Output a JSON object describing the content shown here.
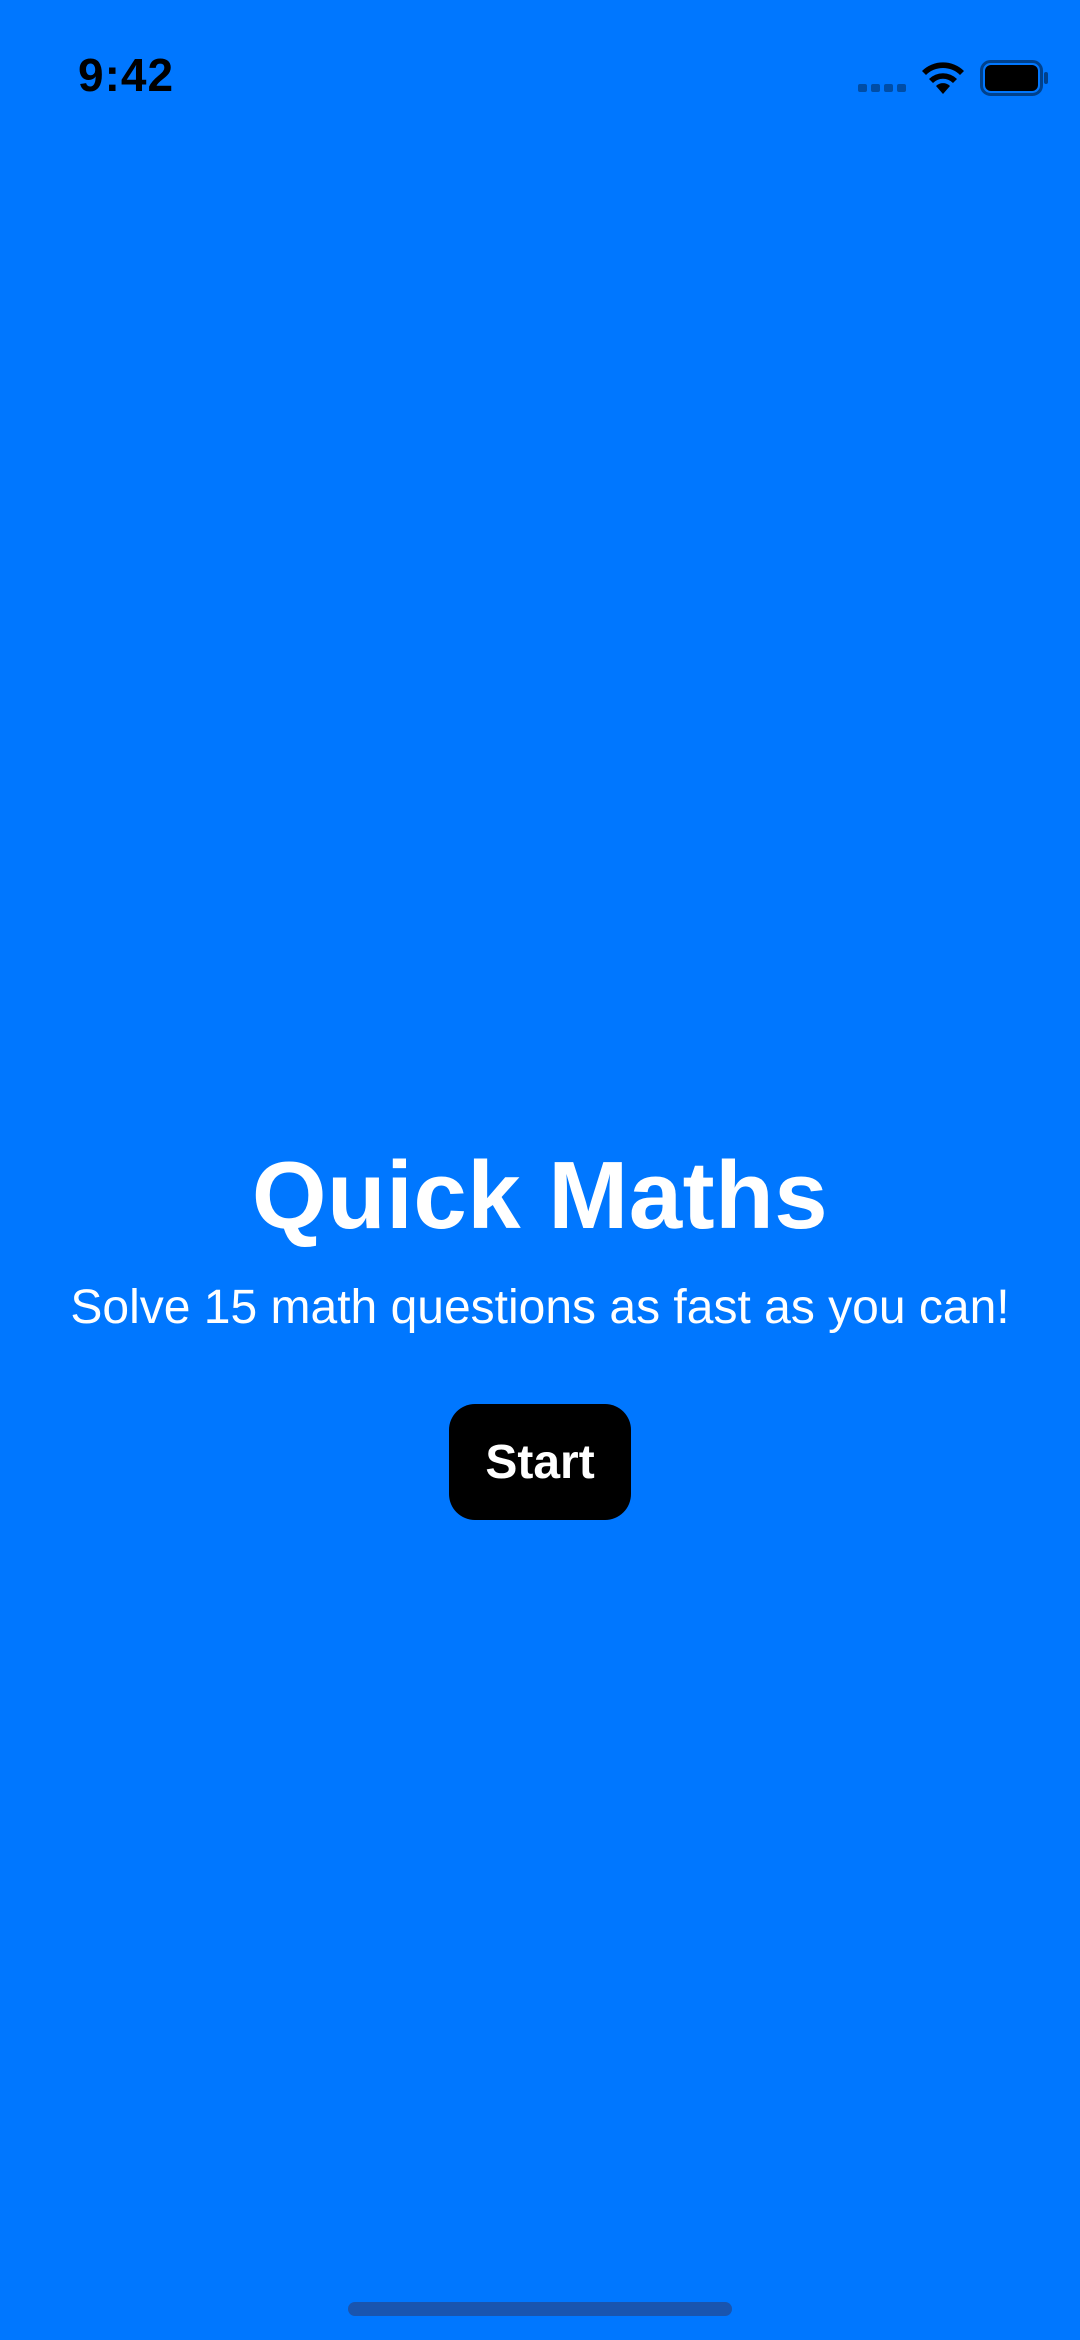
{
  "status_bar": {
    "time": "9:42",
    "icons": [
      "signal-icon",
      "wifi-icon",
      "battery-icon"
    ]
  },
  "main": {
    "title": "Quick Maths",
    "subtitle": "Solve 15 math questions as fast as you can!",
    "start_label": "Start"
  },
  "colors": {
    "background": "#0077FF",
    "button": "#000000",
    "text": "#FFFFFF"
  }
}
